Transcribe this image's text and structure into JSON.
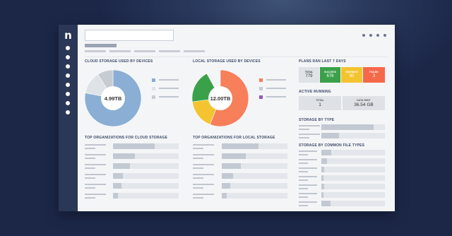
{
  "app": {
    "logo": "n"
  },
  "search": {
    "placeholder": ""
  },
  "sidebar": {
    "items": [
      "nav-1",
      "nav-2",
      "nav-3",
      "nav-4",
      "nav-5",
      "nav-6",
      "nav-7",
      "nav-8"
    ]
  },
  "cloud": {
    "title": "CLOUD STORAGE USED BY DEVICES",
    "center": "4.99TB",
    "legend_colors": [
      "#8aaed4",
      "#dfe3e8",
      "#c7ccd3"
    ]
  },
  "local": {
    "title": "LOCAL STORAGE USED BY DEVICES",
    "center": "12.00TB",
    "legend_colors": [
      "#f77f5a",
      "#c7ccd3",
      "#8e5bc5"
    ]
  },
  "top_cloud": {
    "title": "TOP ORGANIZATIONS FOR CLOUD STORAGE",
    "fills": [
      0.63,
      0.33,
      0.26,
      0.15,
      0.13,
      0.08
    ]
  },
  "top_local": {
    "title": "TOP ORGANIZATIONS FOR LOCAL STORAGE",
    "fills": [
      0.56,
      0.37,
      0.29,
      0.17,
      0.13,
      0.08
    ]
  },
  "plans": {
    "title": "PLANS RAN LAST 7 DAYS",
    "items": [
      {
        "label": "TOTAL",
        "value": "779",
        "color": "#dfe2e6",
        "text": "#333"
      },
      {
        "label": "SUCCESS",
        "value": "678",
        "color": "#3aa14a",
        "text": "#fff"
      },
      {
        "label": "WARNING",
        "value": "90",
        "color": "#f4c430",
        "text": "#fff"
      },
      {
        "label": "FAILED",
        "value": "3",
        "color": "#f5694a",
        "text": "#fff"
      }
    ]
  },
  "active": {
    "title": "ACTIVE RUNNING",
    "items": [
      {
        "label": "TOTAL",
        "value": "1"
      },
      {
        "label": "DATA SENT",
        "value": "36.54 GB"
      }
    ]
  },
  "storage_type": {
    "title": "STORAGE BY TYPE",
    "fills": [
      0.82,
      0.28
    ]
  },
  "storage_file": {
    "title": "STORAGE BY COMMON FILE TYPES",
    "fills": [
      0.16,
      0.09,
      0.04,
      0.03,
      0.04,
      0.03,
      0.14
    ]
  },
  "donut_values": {
    "cloud": [
      0.78,
      0.13,
      0.09
    ],
    "local": [
      0.7,
      0.19,
      0.11
    ]
  }
}
